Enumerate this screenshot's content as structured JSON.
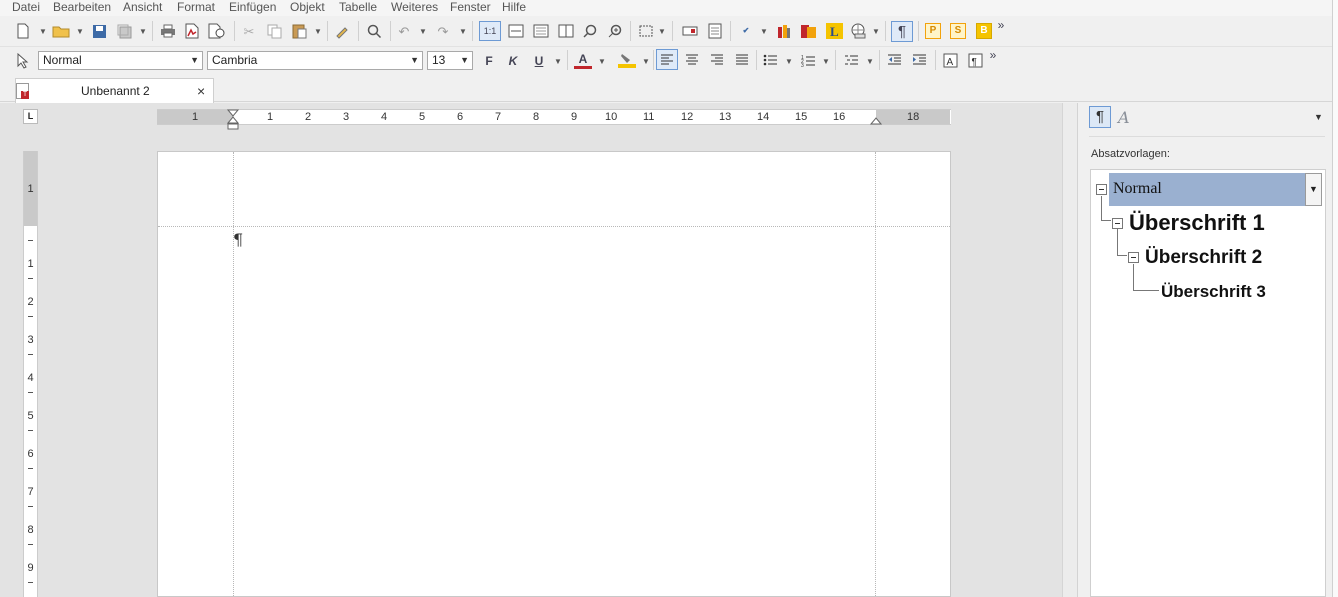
{
  "menu": [
    "Datei",
    "Bearbeiten",
    "Ansicht",
    "Format",
    "Einfügen",
    "Objekt",
    "Tabelle",
    "Weiteres",
    "Fenster",
    "Hilfe"
  ],
  "format_bar": {
    "style_value": "Normal",
    "font_value": "Cambria",
    "size_value": "13",
    "bold_label": "F",
    "italic_label": "K",
    "underline_label": "U",
    "font_color_label": "A"
  },
  "toolbar": {
    "zoom_label": "1:1",
    "pilcrow": "¶",
    "p_label": "P",
    "s_label": "S",
    "b_label": "B",
    "overflow": "»"
  },
  "document_tab": {
    "title": "Unbenannt 2",
    "close": "×"
  },
  "ruler": {
    "corner": "L",
    "h_labels": [
      "1",
      "1",
      "2",
      "3",
      "4",
      "5",
      "6",
      "7",
      "8",
      "9",
      "10",
      "11",
      "12",
      "13",
      "14",
      "15",
      "16",
      "18"
    ],
    "v_labels": [
      "1",
      "1",
      "2",
      "3",
      "4",
      "5",
      "6",
      "7",
      "8",
      "9"
    ]
  },
  "page": {
    "pilcrow": "¶"
  },
  "sidebar": {
    "para_tab": "¶",
    "char_tab": "A",
    "label": "Absatzvorlagen:",
    "styles": [
      "Normal",
      "Überschrift 1",
      "Überschrift 2",
      "Überschrift 3"
    ],
    "selected_index": 0
  },
  "colors": {
    "selection": "#9ab0d0",
    "accent": "#6d9ad4",
    "badge_orange": "#f2a20c"
  }
}
